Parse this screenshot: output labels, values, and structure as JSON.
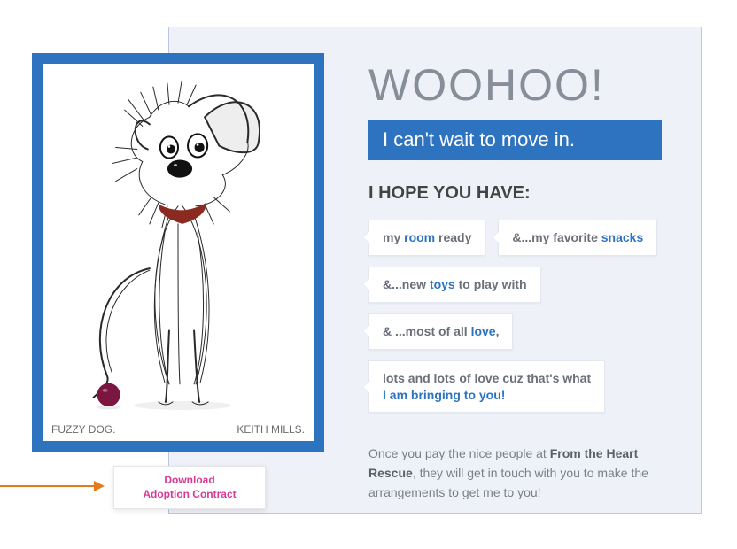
{
  "heading": "WOOHOO!",
  "banner": "I can't wait to move in.",
  "subhead": "I HOPE YOU HAVE:",
  "bubbles": [
    {
      "pre": "my ",
      "hl": "room",
      "post": " ready"
    },
    {
      "pre": "&...my favorite ",
      "hl": "snacks",
      "post": ""
    },
    {
      "pre": "&...new ",
      "hl": "toys",
      "post": " to play with"
    },
    {
      "pre": "& ...most of all ",
      "hl": "love",
      "post": ","
    },
    {
      "pre": "lots and lots of love cuz that's what",
      "hl2": "I am bringing to you!"
    }
  ],
  "para": {
    "a": "Once you pay the nice people at ",
    "b": "From the Heart Rescue",
    "c": ", they will get in touch with you to make the arrangements to get me to you!"
  },
  "art": {
    "caption_left": "FUZZY DOG.",
    "caption_right": "KEITH MILLS."
  },
  "download": {
    "line1": "Download",
    "line2": "Adoption Contract"
  }
}
